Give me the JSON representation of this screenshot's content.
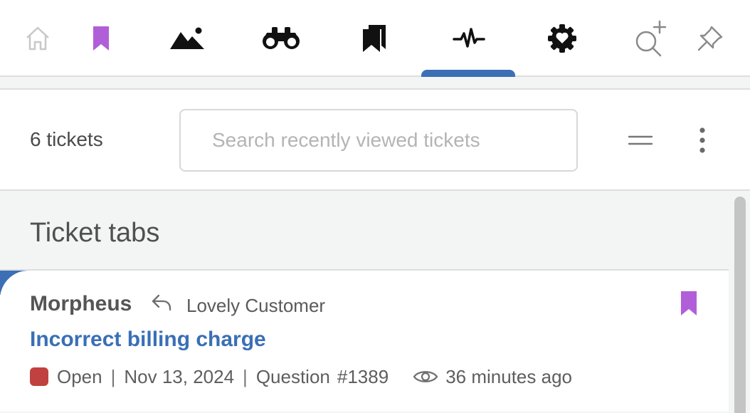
{
  "toolbar": {
    "items": [
      {
        "name": "home",
        "icon": "home-icon"
      },
      {
        "name": "bookmarks",
        "icon": "bookmark-icon"
      },
      {
        "name": "image",
        "icon": "image-icon"
      },
      {
        "name": "watch",
        "icon": "binoculars-icon"
      },
      {
        "name": "saved",
        "icon": "bookmarks-icon"
      },
      {
        "name": "activity",
        "icon": "pulse-icon",
        "active": true
      },
      {
        "name": "settings",
        "icon": "gear-heart-icon"
      },
      {
        "name": "add-search",
        "icon": "search-plus-icon"
      },
      {
        "name": "pin",
        "icon": "pin-icon"
      }
    ],
    "active_color": "#3c6fb5"
  },
  "search": {
    "count_label": "6 tickets",
    "placeholder": "Search recently viewed tickets"
  },
  "section": {
    "title": "Ticket tabs"
  },
  "tickets": [
    {
      "requester": "Morpheus",
      "customer": "Lovely Customer",
      "subject": "Incorrect billing charge",
      "status": "Open",
      "status_color": "#c0413f",
      "date": "Nov 13, 2024",
      "type": "Question",
      "id": "#1389",
      "viewed": "36 minutes ago",
      "bookmarked": true,
      "bookmark_color": "#b15fd8"
    }
  ],
  "colors": {
    "accent": "#3c6fb5",
    "bookmark": "#b15fd8",
    "link": "#3a6fb7"
  }
}
